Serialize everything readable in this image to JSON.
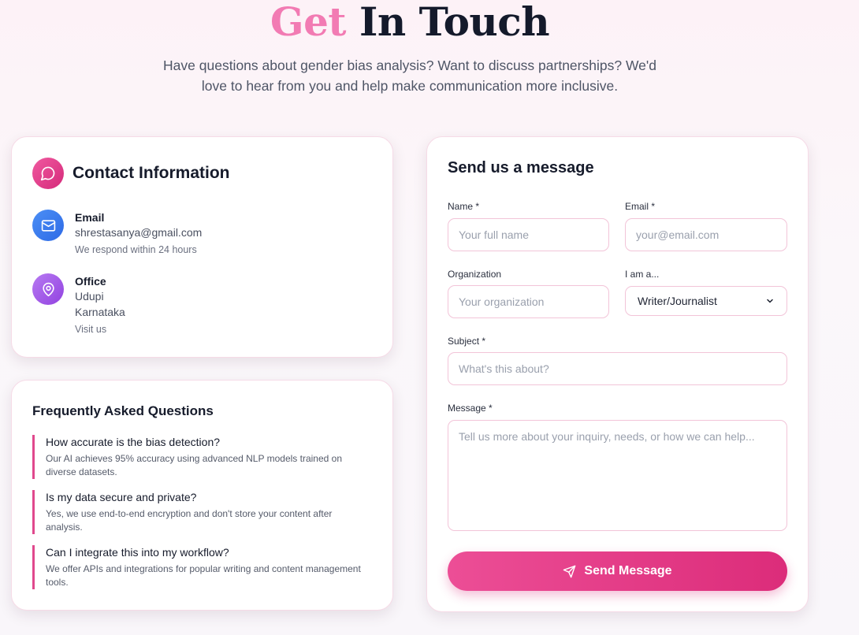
{
  "hero": {
    "title_accent": "Get",
    "title_rest": "In Touch",
    "subtitle": "Have questions about gender bias analysis? Want to discuss partnerships? We'd love to hear from you and help make communication more inclusive."
  },
  "contact": {
    "title": "Contact Information",
    "icon": "message-circle-icon",
    "email": {
      "icon": "mail-icon",
      "label": "Email",
      "value": "shrestasanya@gmail.com",
      "note": "We respond within 24 hours"
    },
    "office": {
      "icon": "map-pin-icon",
      "label": "Office",
      "line1": "Udupi",
      "line2": "Karnataka",
      "note": "Visit us"
    }
  },
  "faq": {
    "title": "Frequently Asked Questions",
    "items": [
      {
        "q": "How accurate is the bias detection?",
        "a": "Our AI achieves 95% accuracy using advanced NLP models trained on diverse datasets."
      },
      {
        "q": "Is my data secure and private?",
        "a": "Yes, we use end-to-end encryption and don't store your content after analysis."
      },
      {
        "q": "Can I integrate this into my workflow?",
        "a": "We offer APIs and integrations for popular writing and content management tools."
      }
    ]
  },
  "form": {
    "title": "Send us a message",
    "name": {
      "label": "Name *",
      "placeholder": "Your full name",
      "value": ""
    },
    "email": {
      "label": "Email *",
      "placeholder": "your@email.com",
      "value": ""
    },
    "organization": {
      "label": "Organization",
      "placeholder": "Your organization",
      "value": ""
    },
    "role": {
      "label": "I am a...",
      "selected": "Writer/Journalist"
    },
    "subject": {
      "label": "Subject *",
      "placeholder": "What's this about?",
      "value": ""
    },
    "message": {
      "label": "Message *",
      "placeholder": "Tell us more about your inquiry, needs, or how we can help...",
      "value": ""
    },
    "submit_label": "Send Message",
    "submit_icon": "send-icon"
  },
  "colors": {
    "accent_pink": "#e0498d",
    "title_pink": "#f27bb3",
    "blue_icon": "#3b7cf0",
    "purple_icon": "#a35ce8",
    "input_border": "#f2c4d8"
  }
}
